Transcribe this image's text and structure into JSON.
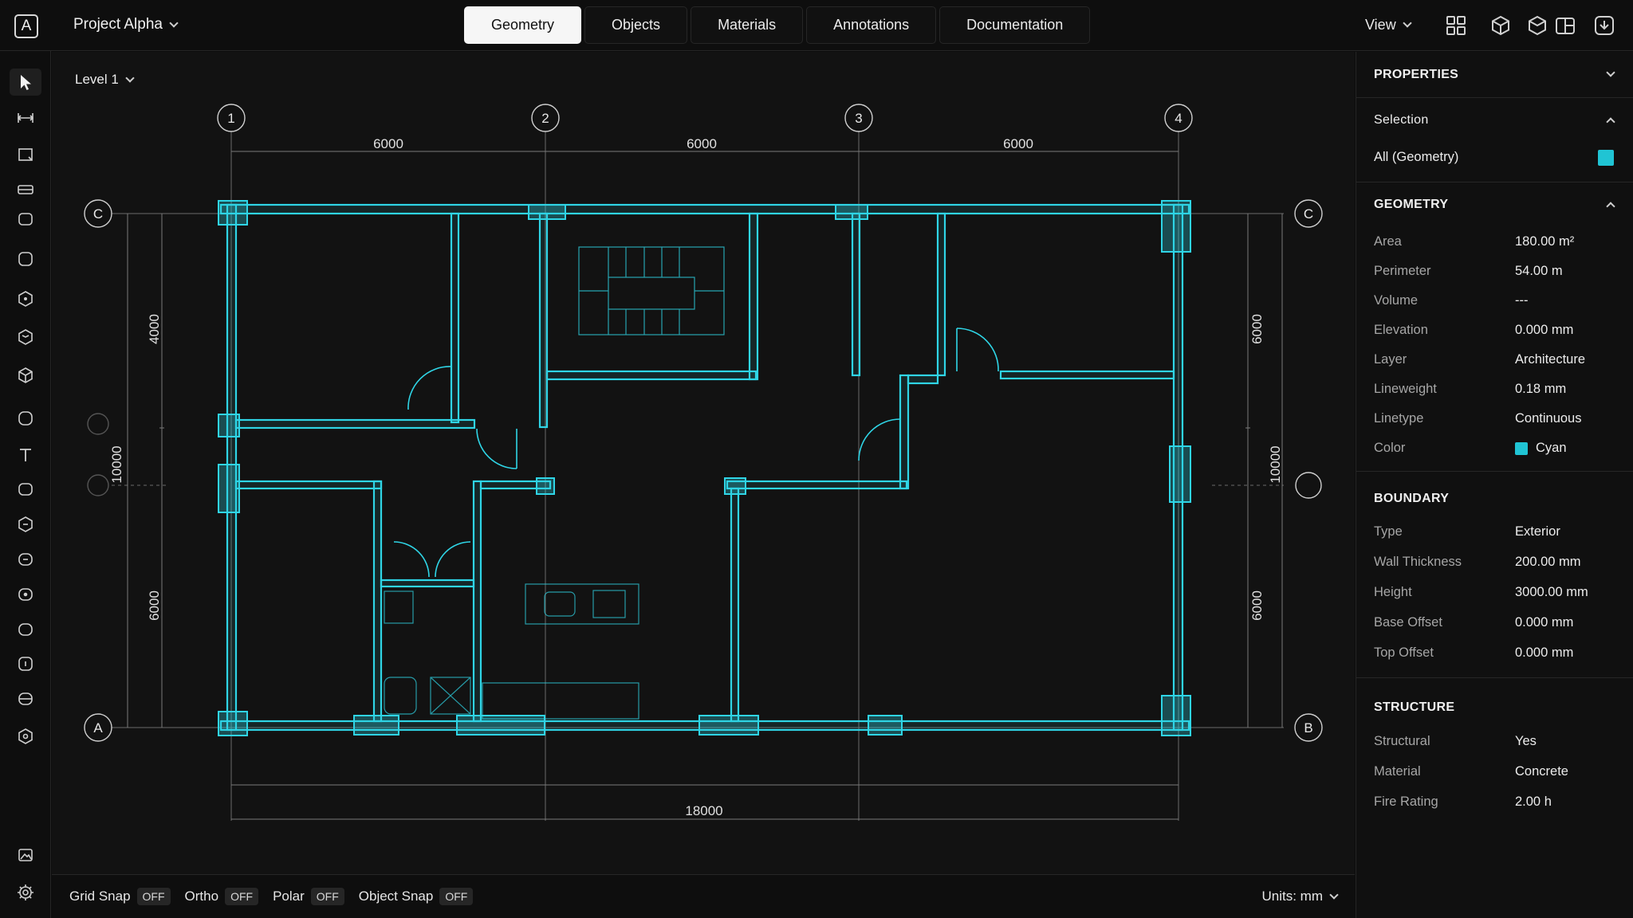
{
  "app": {
    "logo_letter": "A",
    "project_name": "Project Alpha"
  },
  "tabs": [
    {
      "label": "Geometry",
      "active": true
    },
    {
      "label": "Objects"
    },
    {
      "label": "Materials"
    },
    {
      "label": "Annotations"
    },
    {
      "label": "Documentation"
    }
  ],
  "view_menu": {
    "label": "View"
  },
  "toolbar_icons": [
    "layout-grid-icon",
    "cube-icon",
    "cube-split-icon",
    "window-layout-icon",
    "share-icon"
  ],
  "canvas": {
    "level": "Level 1",
    "grid_cols": [
      "1",
      "2",
      "3",
      "4"
    ],
    "grid_rows_left": [
      "C",
      "A"
    ],
    "grid_rows_right": [
      "C",
      "B"
    ],
    "dims_top": [
      "6000",
      "6000",
      "6000"
    ],
    "dim_bottom": "18000",
    "dims_left": [
      "4000",
      "10000",
      "6000"
    ],
    "dims_right": [
      "6000",
      "10000",
      "6000"
    ],
    "accent_color": "#2fd5e6"
  },
  "status": {
    "snaps": [
      {
        "label": "Grid Snap",
        "value": "OFF"
      },
      {
        "label": "Ortho",
        "value": "OFF"
      },
      {
        "label": "Polar",
        "value": "OFF"
      },
      {
        "label": "Object Snap",
        "value": "OFF"
      }
    ],
    "units": "Units: mm"
  },
  "properties": {
    "title": "PROPERTIES",
    "selection": {
      "title": "Selection",
      "value": "All (Geometry)",
      "color": "#20c4d4"
    },
    "geometry": {
      "title": "GEOMETRY",
      "rows": [
        {
          "k": "Area",
          "v": "180.00 m²"
        },
        {
          "k": "Perimeter",
          "v": "54.00 m"
        },
        {
          "k": "Volume",
          "v": "---"
        },
        {
          "k": "Elevation",
          "v": "0.000 mm"
        },
        {
          "k": "Layer",
          "v": "Architecture"
        },
        {
          "k": "Lineweight",
          "v": "0.18 mm"
        },
        {
          "k": "Linetype",
          "v": "Continuous"
        },
        {
          "k": "Color",
          "v": "Cyan"
        }
      ]
    },
    "boundary": {
      "title": "BOUNDARY",
      "rows": [
        {
          "k": "Type",
          "v": "Exterior"
        },
        {
          "k": "Wall Thickness",
          "v": "200.00 mm"
        },
        {
          "k": "Height",
          "v": "3000.00 mm"
        },
        {
          "k": "Base Offset",
          "v": "0.000 mm"
        },
        {
          "k": "Top Offset",
          "v": "0.000 mm"
        }
      ]
    },
    "structure": {
      "title": "STRUCTURE",
      "rows": [
        {
          "k": "Structural",
          "v": "Yes"
        },
        {
          "k": "Material",
          "v": "Concrete"
        },
        {
          "k": "Fire Rating",
          "v": "2.00 h"
        }
      ]
    }
  }
}
